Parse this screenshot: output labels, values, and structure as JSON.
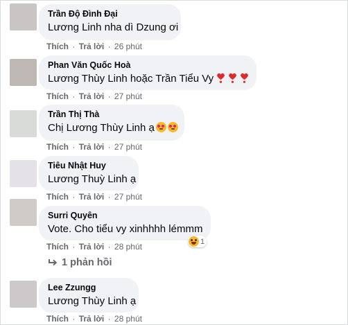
{
  "comments": [
    {
      "author": "Trần Độ Đình Đại",
      "text": "Lương Linh nha dì Dzung ơi",
      "like": "Thích",
      "reply": "Trả lời",
      "dot": "·",
      "time": "26 phút",
      "avatar_color": "#c9c5c4"
    },
    {
      "author": "Phan Văn Quốc Hoà",
      "text": "Lương Thùy Linh hoặc Trần Tiểu Vy",
      "emoji": [
        "heart-exclamation-icon",
        "heart-exclamation-icon",
        "heart-exclamation-icon"
      ],
      "like": "Thích",
      "reply": "Trả lời",
      "dot": "·",
      "time": "27 phút",
      "avatar_color": "#bdb8b4"
    },
    {
      "author": "Trần Thị Thà",
      "text": "Chị Lương Thùy Linh ạ",
      "emoji": [
        "smiling-face-with-hearts-icon",
        "smiling-face-with-hearts-icon"
      ],
      "like": "Thích",
      "reply": "Trả lời",
      "dot": "·",
      "time": "27 phút",
      "avatar_color": "#d9dbd8"
    },
    {
      "author": "Tiêu Nhật Huy",
      "text": "Lương Thuỳ Linh ạ",
      "like": "Thích",
      "reply": "Trả lời",
      "dot": "·",
      "time": "27 phút",
      "avatar_color": "#e4e2e8"
    },
    {
      "author": "Surri Quyên",
      "text": "Vote. Cho tiểu vy xinhhhh lémmm",
      "like": "Thích",
      "reply": "Trả lời",
      "dot": "·",
      "time": "28 phút",
      "avatar_color": "#cfcbc8",
      "reaction": {
        "icon": "laughing-face-icon",
        "count": "1"
      }
    },
    {
      "author": "Lee Zzungg",
      "text": "Lương Thùy Linh ạ",
      "like": "Thích",
      "reply": "Trả lời",
      "dot": "·",
      "time": "28 phút",
      "avatar_color": "#cdc8c9"
    }
  ],
  "replies_link": {
    "label": "1 phản hồi",
    "icon": "reply-arrow-icon"
  },
  "colors": {
    "bubble": "#f0f2f5",
    "meta": "#65676b",
    "text": "#050505",
    "heart": "#e02a2a"
  }
}
